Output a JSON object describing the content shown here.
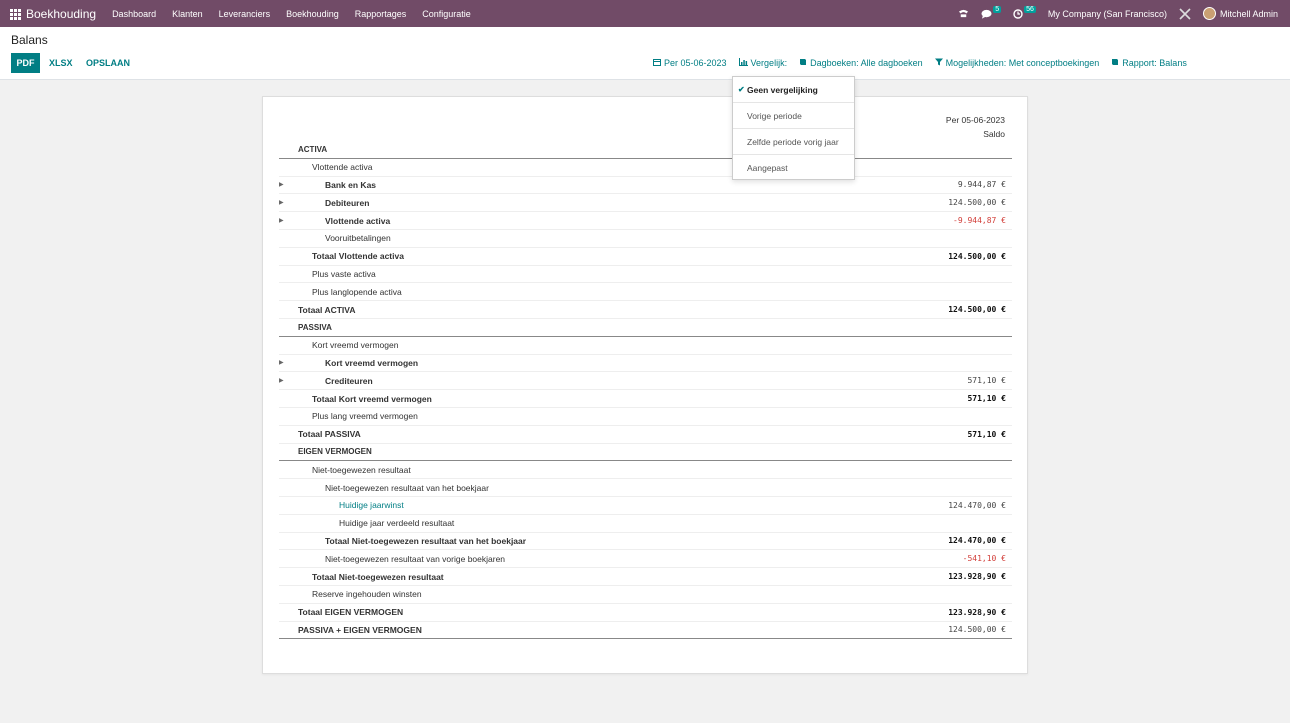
{
  "navbar": {
    "app_name": "Boekhouding",
    "menu": [
      "Dashboard",
      "Klanten",
      "Leveranciers",
      "Boekhouding",
      "Rapportages",
      "Configuratie"
    ],
    "messages_count": "5",
    "activities_count": "56",
    "company": "My Company (San Francisco)",
    "user": "Mitchell Admin"
  },
  "control": {
    "title": "Balans",
    "pdf": "PDF",
    "xlsx": "XLSX",
    "save": "OPSLAAN",
    "filters": {
      "date": "Per 05-06-2023",
      "compare": "Vergelijk:",
      "journals": "Dagboeken: Alle dagboeken",
      "options": "Mogelijkheden: Met conceptboekingen",
      "report": "Rapport: Balans"
    }
  },
  "dropdown": {
    "items": [
      "Geen vergelijking",
      "Vorige periode",
      "Zelfde periode vorig jaar",
      "Aangepast"
    ]
  },
  "report": {
    "date_header": "Per 05-06-2023",
    "col_header": "Saldo",
    "rows": [
      {
        "label": "ACTIVA",
        "value": ""
      },
      {
        "label": "Vlottende activa",
        "value": ""
      },
      {
        "label": "Bank en Kas",
        "value": "9.944,87 €"
      },
      {
        "label": "Debiteuren",
        "value": "124.500,00 €"
      },
      {
        "label": "Vlottende activa",
        "value": "-9.944,87 €"
      },
      {
        "label": "Vooruitbetalingen",
        "value": ""
      },
      {
        "label": "Totaal Vlottende activa",
        "value": "124.500,00 €"
      },
      {
        "label": "Plus vaste activa",
        "value": ""
      },
      {
        "label": "Plus langlopende activa",
        "value": ""
      },
      {
        "label": "Totaal ACTIVA",
        "value": "124.500,00 €"
      },
      {
        "label": "PASSIVA",
        "value": ""
      },
      {
        "label": "Kort vreemd vermogen",
        "value": ""
      },
      {
        "label": "Kort vreemd vermogen",
        "value": ""
      },
      {
        "label": "Crediteuren",
        "value": "571,10 €"
      },
      {
        "label": "Totaal Kort vreemd vermogen",
        "value": "571,10 €"
      },
      {
        "label": "Plus lang vreemd vermogen",
        "value": ""
      },
      {
        "label": "Totaal PASSIVA",
        "value": "571,10 €"
      },
      {
        "label": "EIGEN VERMOGEN",
        "value": ""
      },
      {
        "label": "Niet-toegewezen resultaat",
        "value": ""
      },
      {
        "label": "Niet-toegewezen resultaat van het boekjaar",
        "value": ""
      },
      {
        "label": "Huidige jaarwinst",
        "value": "124.470,00 €"
      },
      {
        "label": "Huidige jaar verdeeld resultaat",
        "value": ""
      },
      {
        "label": "Totaal Niet-toegewezen resultaat van het boekjaar",
        "value": "124.470,00 €"
      },
      {
        "label": "Niet-toegewezen resultaat van vorige boekjaren",
        "value": "-541,10 €"
      },
      {
        "label": "Totaal Niet-toegewezen resultaat",
        "value": "123.928,90 €"
      },
      {
        "label": "Reserve ingehouden winsten",
        "value": ""
      },
      {
        "label": "Totaal EIGEN VERMOGEN",
        "value": "123.928,90 €"
      },
      {
        "label": "PASSIVA + EIGEN VERMOGEN",
        "value": "124.500,00 €"
      }
    ]
  }
}
